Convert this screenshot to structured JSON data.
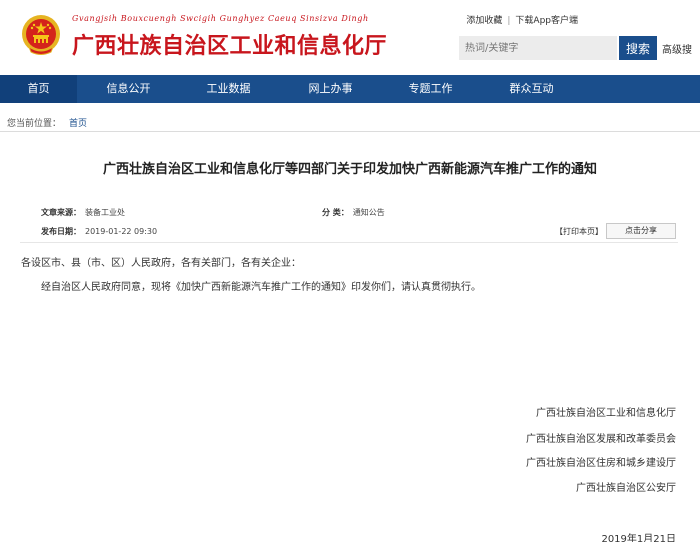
{
  "header": {
    "subtitle": "Gvangjsih Bouxcuengh Swcigih Gunghyez Caeuq Sinsizva Dingh",
    "site_name": "广西壮族自治区工业和信息化厅",
    "links": [
      "添加收藏",
      "下载App客户端"
    ],
    "search_placeholder": "热词/关键字",
    "search_button": "搜索",
    "search_extra": "高级搜"
  },
  "nav": {
    "items": [
      "首页",
      "信息公开",
      "工业数据",
      "网上办事",
      "专题工作",
      "群众互动"
    ],
    "active_index": 0
  },
  "breadcrumb": {
    "label": "您当前位置：",
    "home": "首页"
  },
  "article": {
    "title": "广西壮族自治区工业和信息化厅等四部门关于印发加快广西新能源汽车推广工作的通知",
    "source_label": "文章来源：",
    "source": "装备工业处",
    "category_label": "分 类：",
    "category": "通知公告",
    "date_label": "发布日期：",
    "date": "2019-01-22 09:30",
    "print_label": "【打印本页】",
    "share_label": "点击分享",
    "paragraphs": [
      "各设区市、县（市、区）人民政府，各有关部门，各有关企业：",
      "经自治区人民政府同意，现将《加快广西新能源汽车推广工作的通知》印发你们，请认真贯彻执行。"
    ],
    "signatories": [
      "广西壮族自治区工业和信息化厅",
      "广西壮族自治区发展和改革委员会",
      "广西壮族自治区住房和城乡建设厅",
      "广西壮族自治区公安厅"
    ],
    "sign_date": "2019年1月21日"
  },
  "colors": {
    "brand_red": "#c8161d",
    "nav_blue": "#1a4e8c",
    "emblem_gold": "#e6b422"
  }
}
